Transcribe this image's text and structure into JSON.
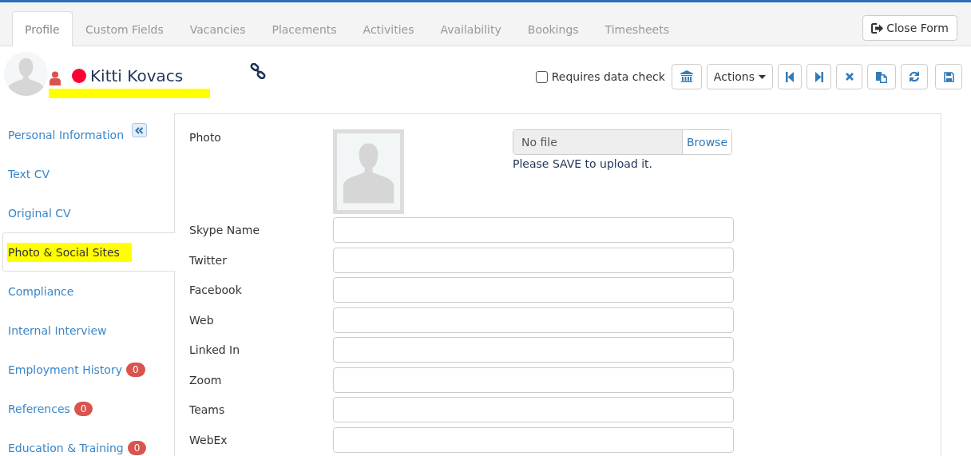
{
  "tabs": [
    {
      "label": "Profile",
      "selected": true
    },
    {
      "label": "Custom Fields",
      "selected": false
    },
    {
      "label": "Vacancies",
      "selected": false
    },
    {
      "label": "Placements",
      "selected": false
    },
    {
      "label": "Activities",
      "selected": false
    },
    {
      "label": "Availability",
      "selected": false
    },
    {
      "label": "Bookings",
      "selected": false
    },
    {
      "label": "Timesheets",
      "selected": false
    }
  ],
  "close_button": "Close Form",
  "header": {
    "name": "Kitti Kovacs",
    "name_highlighted": true
  },
  "data_check": {
    "label": "Requires data check",
    "checked": false
  },
  "actions_button": "Actions",
  "sidebar": {
    "items": [
      {
        "label": "Personal Information",
        "selected": false,
        "highlighted": false
      },
      {
        "label": "Text CV",
        "selected": false,
        "highlighted": false
      },
      {
        "label": "Original CV",
        "selected": false,
        "highlighted": false
      },
      {
        "label": "Photo & Social Sites",
        "selected": true,
        "highlighted": true
      },
      {
        "label": "Compliance",
        "selected": false,
        "highlighted": false
      },
      {
        "label": "Internal Interview",
        "selected": false,
        "highlighted": false
      },
      {
        "label": "Employment History",
        "selected": false,
        "highlighted": false,
        "badge": "0"
      },
      {
        "label": "References",
        "selected": false,
        "highlighted": false,
        "badge": "0"
      },
      {
        "label": "Education & Training",
        "selected": false,
        "highlighted": false,
        "badge": "0"
      }
    ]
  },
  "form": {
    "photo_label": "Photo",
    "file": {
      "value": "No file",
      "button": "Browse"
    },
    "hint": "Please SAVE to upload it.",
    "fields": [
      {
        "label": "Skype Name"
      },
      {
        "label": "Twitter"
      },
      {
        "label": "Facebook"
      },
      {
        "label": "Web"
      },
      {
        "label": "Linked In"
      },
      {
        "label": "Zoom"
      },
      {
        "label": "Teams"
      },
      {
        "label": "WebEx"
      }
    ]
  }
}
